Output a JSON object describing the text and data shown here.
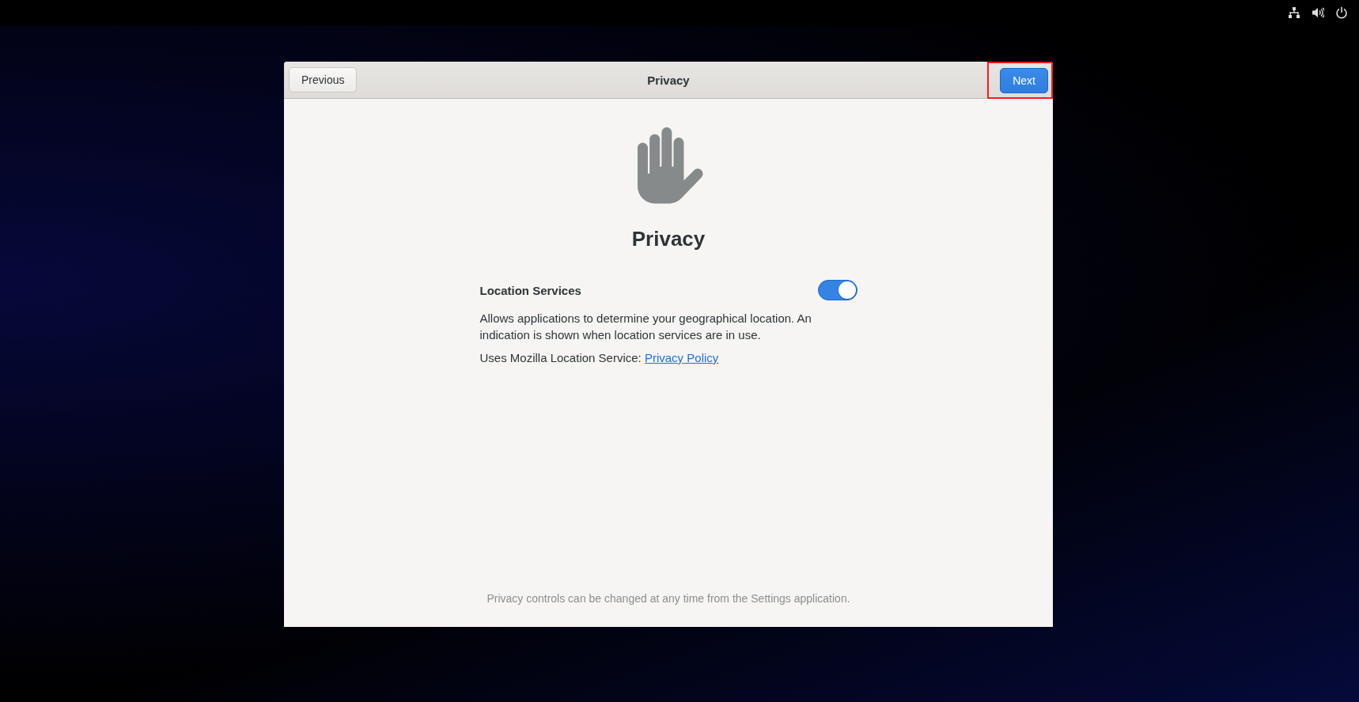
{
  "top_bar": {
    "icons": [
      {
        "kind": "network"
      },
      {
        "kind": "volume"
      },
      {
        "kind": "power"
      }
    ]
  },
  "window": {
    "title": "Privacy",
    "previous_button": {
      "label": "Previous"
    },
    "next_button": {
      "label": "Next",
      "highlighted": true
    }
  },
  "page": {
    "heading": "Privacy",
    "location_services": {
      "label": "Location Services",
      "on": true,
      "description": "Allows applications to determine your geographical location. An indication is shown when location services are in use.",
      "provider_text": "Uses Mozilla Location Service:",
      "policy_link": "Privacy Policy"
    },
    "footer": "Privacy controls can be changed at any time from the Settings application."
  }
}
